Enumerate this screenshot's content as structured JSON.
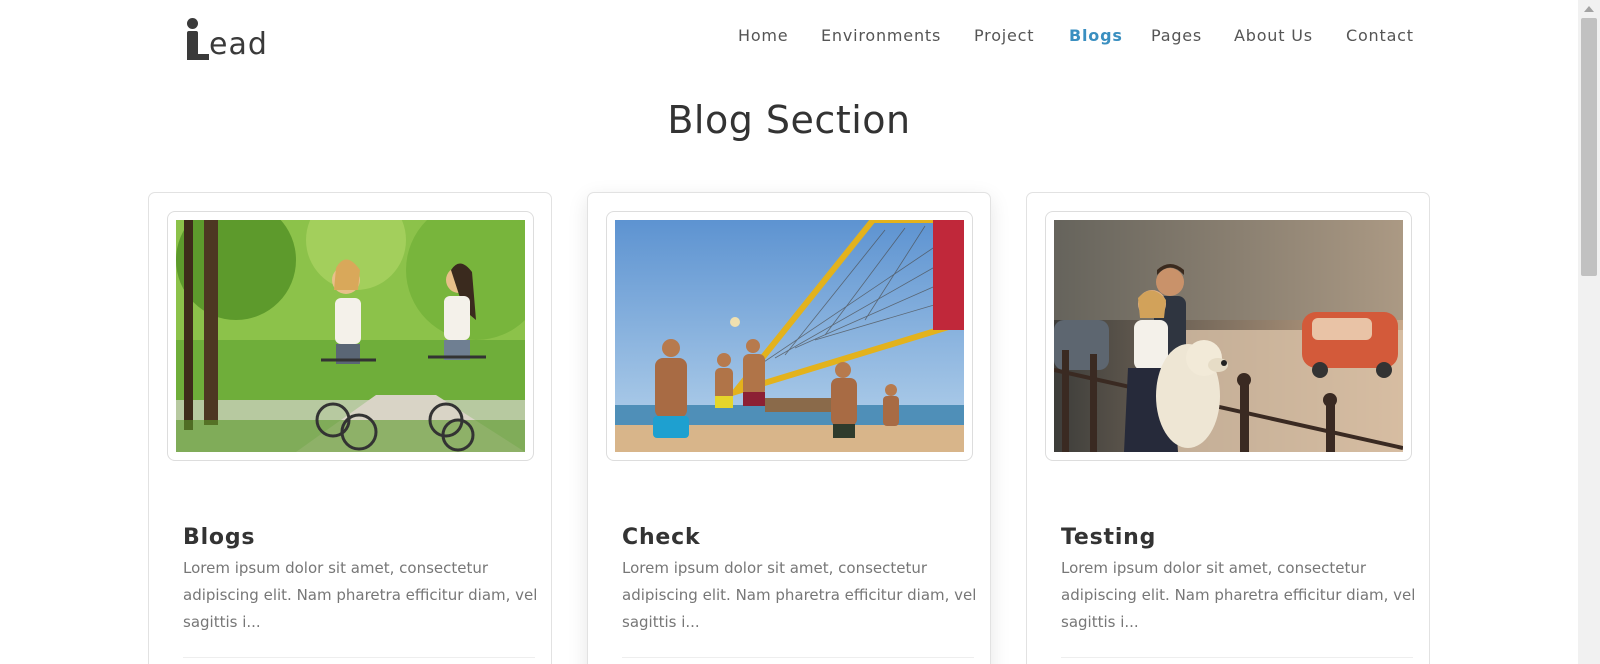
{
  "header": {
    "logo_text": "ead",
    "nav": [
      {
        "label": "Home",
        "active": false
      },
      {
        "label": "Environments",
        "active": false
      },
      {
        "label": "Project",
        "active": false
      },
      {
        "label": "Blogs",
        "active": true
      },
      {
        "label": "Pages",
        "active": false
      },
      {
        "label": "About Us",
        "active": false
      },
      {
        "label": "Contact",
        "active": false
      }
    ]
  },
  "main": {
    "title": "Blog Section",
    "cards": [
      {
        "title": "Blogs",
        "excerpt": "Lorem ipsum dolor sit amet, consectetur adipiscing elit. Nam pharetra efficitur diam, vel sagittis i...",
        "image": "two-women-cycling-in-park-photo"
      },
      {
        "title": "Check",
        "excerpt": "Lorem ipsum dolor sit amet, consectetur adipiscing elit. Nam pharetra efficitur diam, vel sagittis i...",
        "image": "beach-volleyball-photo"
      },
      {
        "title": "Testing",
        "excerpt": "Lorem ipsum dolor sit amet, consectetur adipiscing elit. Nam pharetra efficitur diam, vel sagittis i...",
        "image": "couple-with-dog-on-street-photo"
      }
    ]
  },
  "colors": {
    "accent": "#3a8fc0",
    "text_dark": "#333333",
    "text_muted": "#777777",
    "nav_text": "#555555"
  }
}
